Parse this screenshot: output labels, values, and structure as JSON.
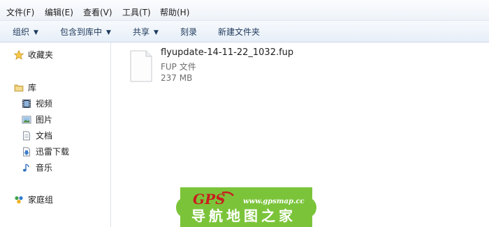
{
  "menu": {
    "file": "文件(F)",
    "edit": "编辑(E)",
    "view": "查看(V)",
    "tools": "工具(T)",
    "help": "帮助(H)"
  },
  "toolbar": {
    "organize": "组织",
    "include_in_library": "包含到库中",
    "share": "共享",
    "burn": "刻录",
    "new_folder": "新建文件夹",
    "caret": "▼"
  },
  "nav": {
    "favorites": "收藏夹",
    "libraries": "库",
    "videos": "视频",
    "pictures": "图片",
    "documents": "文档",
    "thunder_downloads": "迅雷下载",
    "music": "音乐",
    "homegroup": "家庭组"
  },
  "file": {
    "name": "flyupdate-14-11-22_1032.fup",
    "type": "FUP 文件",
    "size": "237 MB"
  },
  "watermark": {
    "brand": "GPS",
    "url": "www.gpsmap.cc",
    "slogan": "导航地图之家"
  },
  "colors": {
    "command_text": "#1e395b",
    "watermark_green": "#7bc43a"
  }
}
